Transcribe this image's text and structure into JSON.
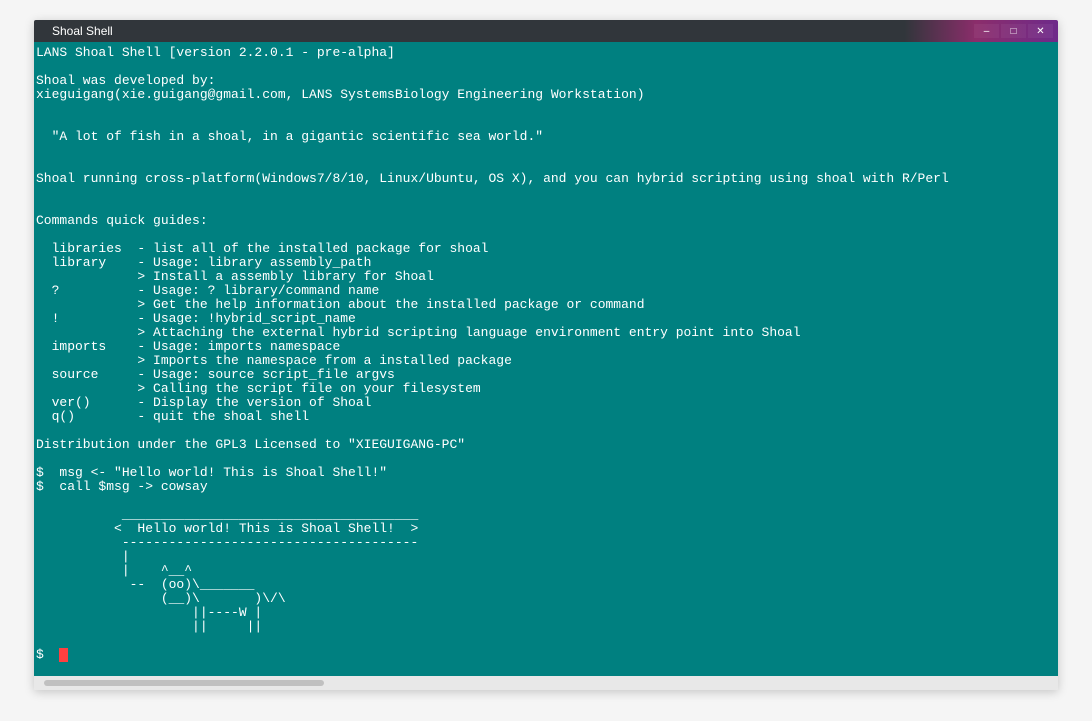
{
  "window": {
    "title": "Shoal Shell"
  },
  "terminal": {
    "header_line": "LANS Shoal Shell [version 2.2.0.1 - pre-alpha]",
    "dev_by_line": "Shoal was developed by:",
    "dev_info": "xieguigang(xie.guigang@gmail.com, LANS SystemsBiology Engineering Workstation)",
    "motto": "  \"A lot of fish in a shoal, in a gigantic scientific sea world.\"",
    "platform": "Shoal running cross-platform(Windows7/8/10, Linux/Ubuntu, OS X), and you can hybrid scripting using shoal with R/Perl",
    "guides_header": "Commands quick guides:",
    "cmd_libraries": "  libraries  - list all of the installed package for shoal",
    "cmd_library1": "  library    - Usage: library assembly_path",
    "cmd_library2": "             > Install a assembly library for Shoal",
    "cmd_help1": "  ?          - Usage: ? library/command name",
    "cmd_help2": "             > Get the help information about the installed package or command",
    "cmd_bang1": "  !          - Usage: !hybrid_script_name",
    "cmd_bang2": "             > Attaching the external hybrid scripting language environment entry point into Shoal",
    "cmd_imports1": "  imports    - Usage: imports namespace",
    "cmd_imports2": "             > Imports the namespace from a installed package",
    "cmd_source1": "  source     - Usage: source script_file argvs",
    "cmd_source2": "             > Calling the script file on your filesystem",
    "cmd_ver": "  ver()      - Display the version of Shoal",
    "cmd_q": "  q()        - quit the shoal shell",
    "dist": "Distribution under the GPL3 Licensed to \"XIEGUIGANG-PC\"",
    "input1": "$  msg <- \"Hello world! This is Shoal Shell!\"",
    "input2": "$  call $msg -> cowsay",
    "cow1": "           ______________________________________",
    "cow2": "          <  Hello world! This is Shoal Shell!  >",
    "cow3": "           --------------------------------------",
    "cow4": "           |",
    "cow5": "           |    ^__^",
    "cow6": "            --  (oo)\\_______",
    "cow7": "                (__)\\       )\\/\\",
    "cow8": "                    ||----W |",
    "cow9": "                    ||     ||",
    "prompt": "$  "
  }
}
